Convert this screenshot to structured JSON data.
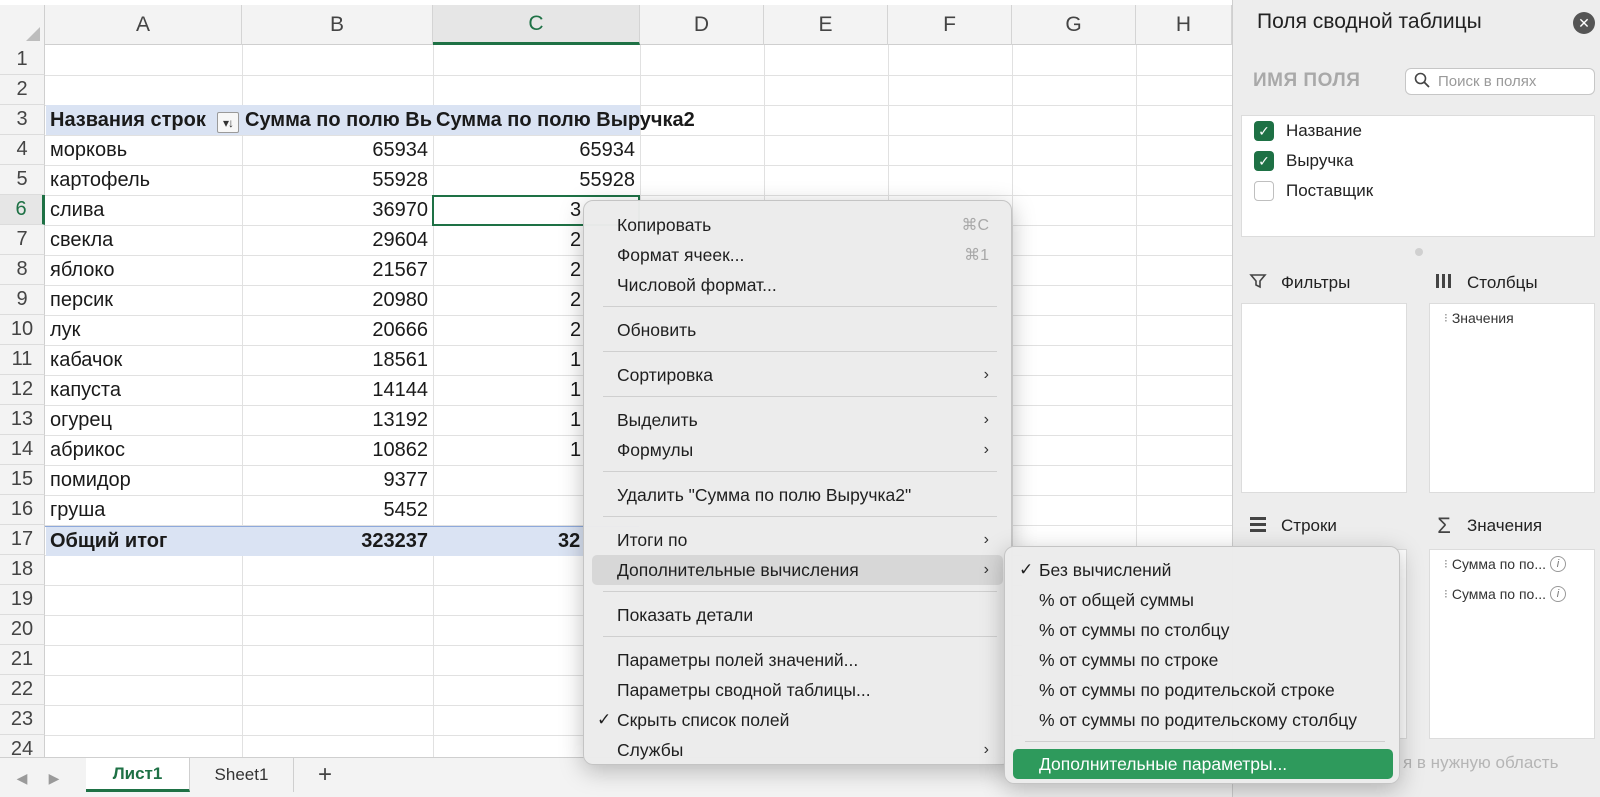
{
  "sheet": {
    "columns": [
      "A",
      "B",
      "C",
      "D",
      "E",
      "F",
      "G",
      "H"
    ],
    "row_numbers": [
      "1",
      "2",
      "3",
      "4",
      "5",
      "6",
      "7",
      "8",
      "9",
      "10",
      "11",
      "12",
      "13",
      "14",
      "15",
      "16",
      "17",
      "18",
      "19",
      "20",
      "21",
      "22",
      "23",
      "24"
    ],
    "pivot": {
      "header_a": "Названия строк",
      "header_b": "Сумма по полю Вь",
      "header_c": "Сумма по полю Выручка2",
      "filter_icon": "filter-sort-icon",
      "rows": [
        {
          "name": "морковь",
          "b": "65934",
          "c": "65934"
        },
        {
          "name": "картофель",
          "b": "55928",
          "c": "55928"
        },
        {
          "name": "слива",
          "b": "36970",
          "c": "3"
        },
        {
          "name": "свекла",
          "b": "29604",
          "c": "2"
        },
        {
          "name": "яблоко",
          "b": "21567",
          "c": "2"
        },
        {
          "name": "персик",
          "b": "20980",
          "c": "2"
        },
        {
          "name": "лук",
          "b": "20666",
          "c": "2"
        },
        {
          "name": "кабачок",
          "b": "18561",
          "c": "1"
        },
        {
          "name": "капуста",
          "b": "14144",
          "c": "1"
        },
        {
          "name": "огурец",
          "b": "13192",
          "c": "1"
        },
        {
          "name": "абрикос",
          "b": "10862",
          "c": "1"
        },
        {
          "name": "помидор",
          "b": "9377",
          "c": ""
        },
        {
          "name": "груша",
          "b": "5452",
          "c": ""
        }
      ],
      "total_label": "Общий итог",
      "total_b": "323237",
      "total_c": "32"
    }
  },
  "tabs": {
    "sheets": [
      "Лист1",
      "Sheet1"
    ],
    "add": "+",
    "prev": "◀",
    "next": "▶"
  },
  "pane": {
    "title": "Поля сводной таблицы",
    "close": "✕",
    "field_name_label": "ИМЯ ПОЛЯ",
    "search_placeholder": "Поиск в полях",
    "fields": [
      {
        "label": "Название",
        "checked": true
      },
      {
        "label": "Выручка",
        "checked": true
      },
      {
        "label": "Поставщик",
        "checked": false
      }
    ],
    "filters_label": "Фильтры",
    "columns_label": "Столбцы",
    "columns_item": "Значения",
    "rows_label": "Строки",
    "values_label": "Значения",
    "values_items": [
      "Сумма по по...",
      "Сумма по по..."
    ],
    "hint": "я в нужную область"
  },
  "context_menu": {
    "copy": "Копировать",
    "copy_sc": "⌘C",
    "format_cells": "Формат ячеек...",
    "format_cells_sc": "⌘1",
    "number_format": "Числовой формат...",
    "refresh": "Обновить",
    "sort": "Сортировка",
    "select": "Выделить",
    "formulas": "Формулы",
    "delete": "Удалить \"Сумма по полю Выручка2\"",
    "summarize_by": "Итоги по",
    "show_values_as": "Дополнительные вычисления",
    "show_details": "Показать детали",
    "value_field_settings": "Параметры полей значений...",
    "pivot_options": "Параметры сводной таблицы...",
    "hide_field_list": "Скрыть список полей",
    "services": "Службы",
    "arrow": "›",
    "check": "✓"
  },
  "submenu": {
    "items": [
      "Без вычислений",
      "% от общей суммы",
      "% от суммы по столбцу",
      "% от суммы по строке",
      "% от суммы по родительской строке",
      "% от суммы по родительскому столбцу"
    ],
    "more_options": "Дополнительные параметры...",
    "check": "✓"
  },
  "colors": {
    "accent": "#1e7145",
    "header_band": "#dae3f3",
    "menu_primary": "#2e9a5c"
  }
}
